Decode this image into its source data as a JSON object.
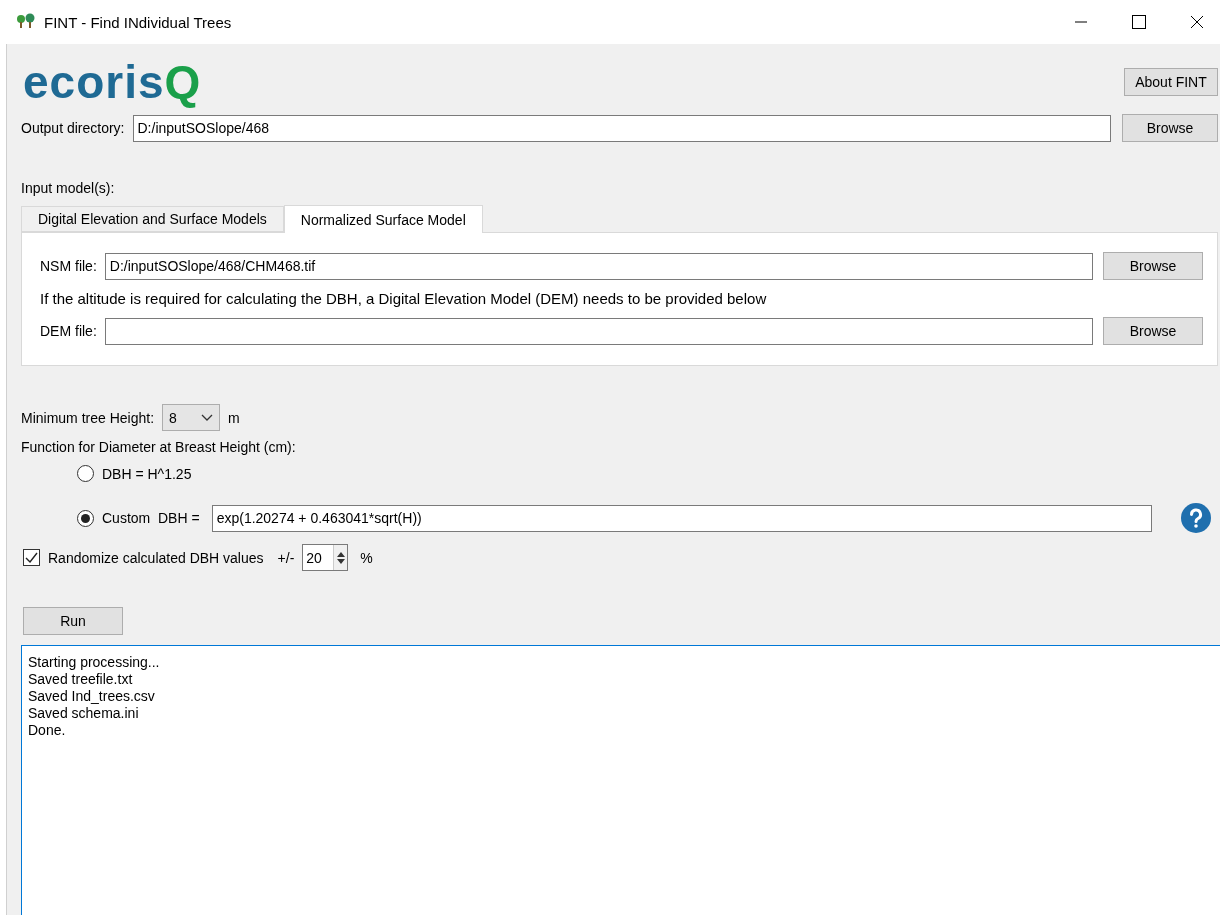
{
  "window": {
    "title": "FINT - Find INdividual Trees"
  },
  "logo": {
    "text": "ecoris",
    "accent": "Q"
  },
  "about_button": "About FINT",
  "output_directory": {
    "label": "Output directory:",
    "value": "D:/inputSOSlope/468",
    "button": "Browse"
  },
  "input_models": {
    "label": "Input model(s):",
    "tabs": [
      {
        "label": "Digital Elevation and Surface Models",
        "selected": false
      },
      {
        "label": "Normalized Surface Model",
        "selected": true
      }
    ],
    "nsm_file": {
      "label": "NSM file:",
      "value": "D:/inputSOSlope/468/CHM468.tif",
      "button": "Browse"
    },
    "note": "If the altitude is required for calculating the DBH, a Digital Elevation Model (DEM) needs to be provided below",
    "dem_file": {
      "label": "DEM file:",
      "button": "Browse"
    }
  },
  "min_height": {
    "label": "Minimum tree Height:",
    "value": "8",
    "unit": "m"
  },
  "dbh_function": {
    "label": "Function for Diameter at Breast Height (cm):",
    "options": [
      {
        "label": "DBH = H^1.25",
        "selected": false
      },
      {
        "label": "Custom  DBH =",
        "selected": true,
        "value": "exp(1.20274 + 0.463041*sqrt(H))"
      }
    ]
  },
  "randomize": {
    "label": "Randomize calculated DBH values",
    "checked": true,
    "prefix": "+/-",
    "value": "20",
    "unit": "%"
  },
  "run_button": "Run",
  "log": [
    "Starting processing...",
    "Saved treefile.txt",
    "Saved Ind_trees.csv",
    "Saved schema.ini",
    "Done."
  ]
}
